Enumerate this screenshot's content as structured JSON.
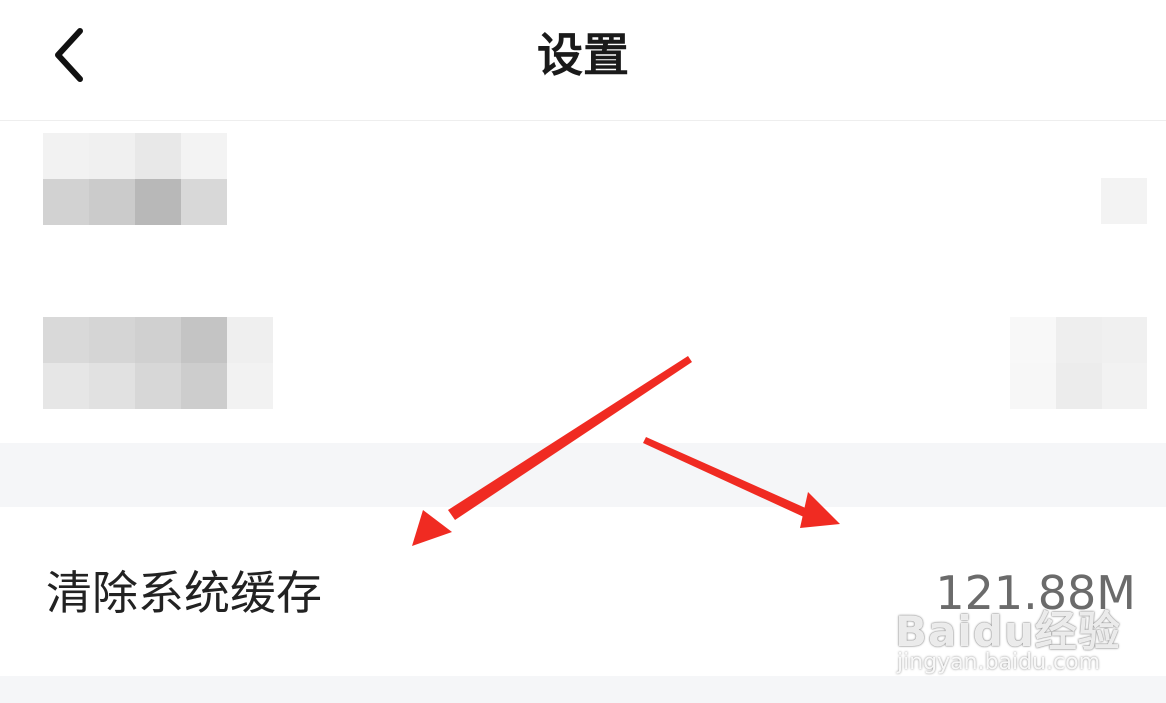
{
  "header": {
    "back_icon": "chevron-left-icon",
    "title": "设置"
  },
  "settings": {
    "clear_cache_label": "清除系统缓存",
    "cache_size": "121.88M"
  },
  "watermark": {
    "logo_text": "Baidu经验",
    "url_text": "jingyan.baidu.com"
  },
  "colors": {
    "background": "#ffffff",
    "section_gap": "#f5f6f8",
    "title_text": "#1a1a1a",
    "label_text": "#222222",
    "value_text": "#6b6b6b",
    "annotation_arrow": "#f02b22"
  }
}
